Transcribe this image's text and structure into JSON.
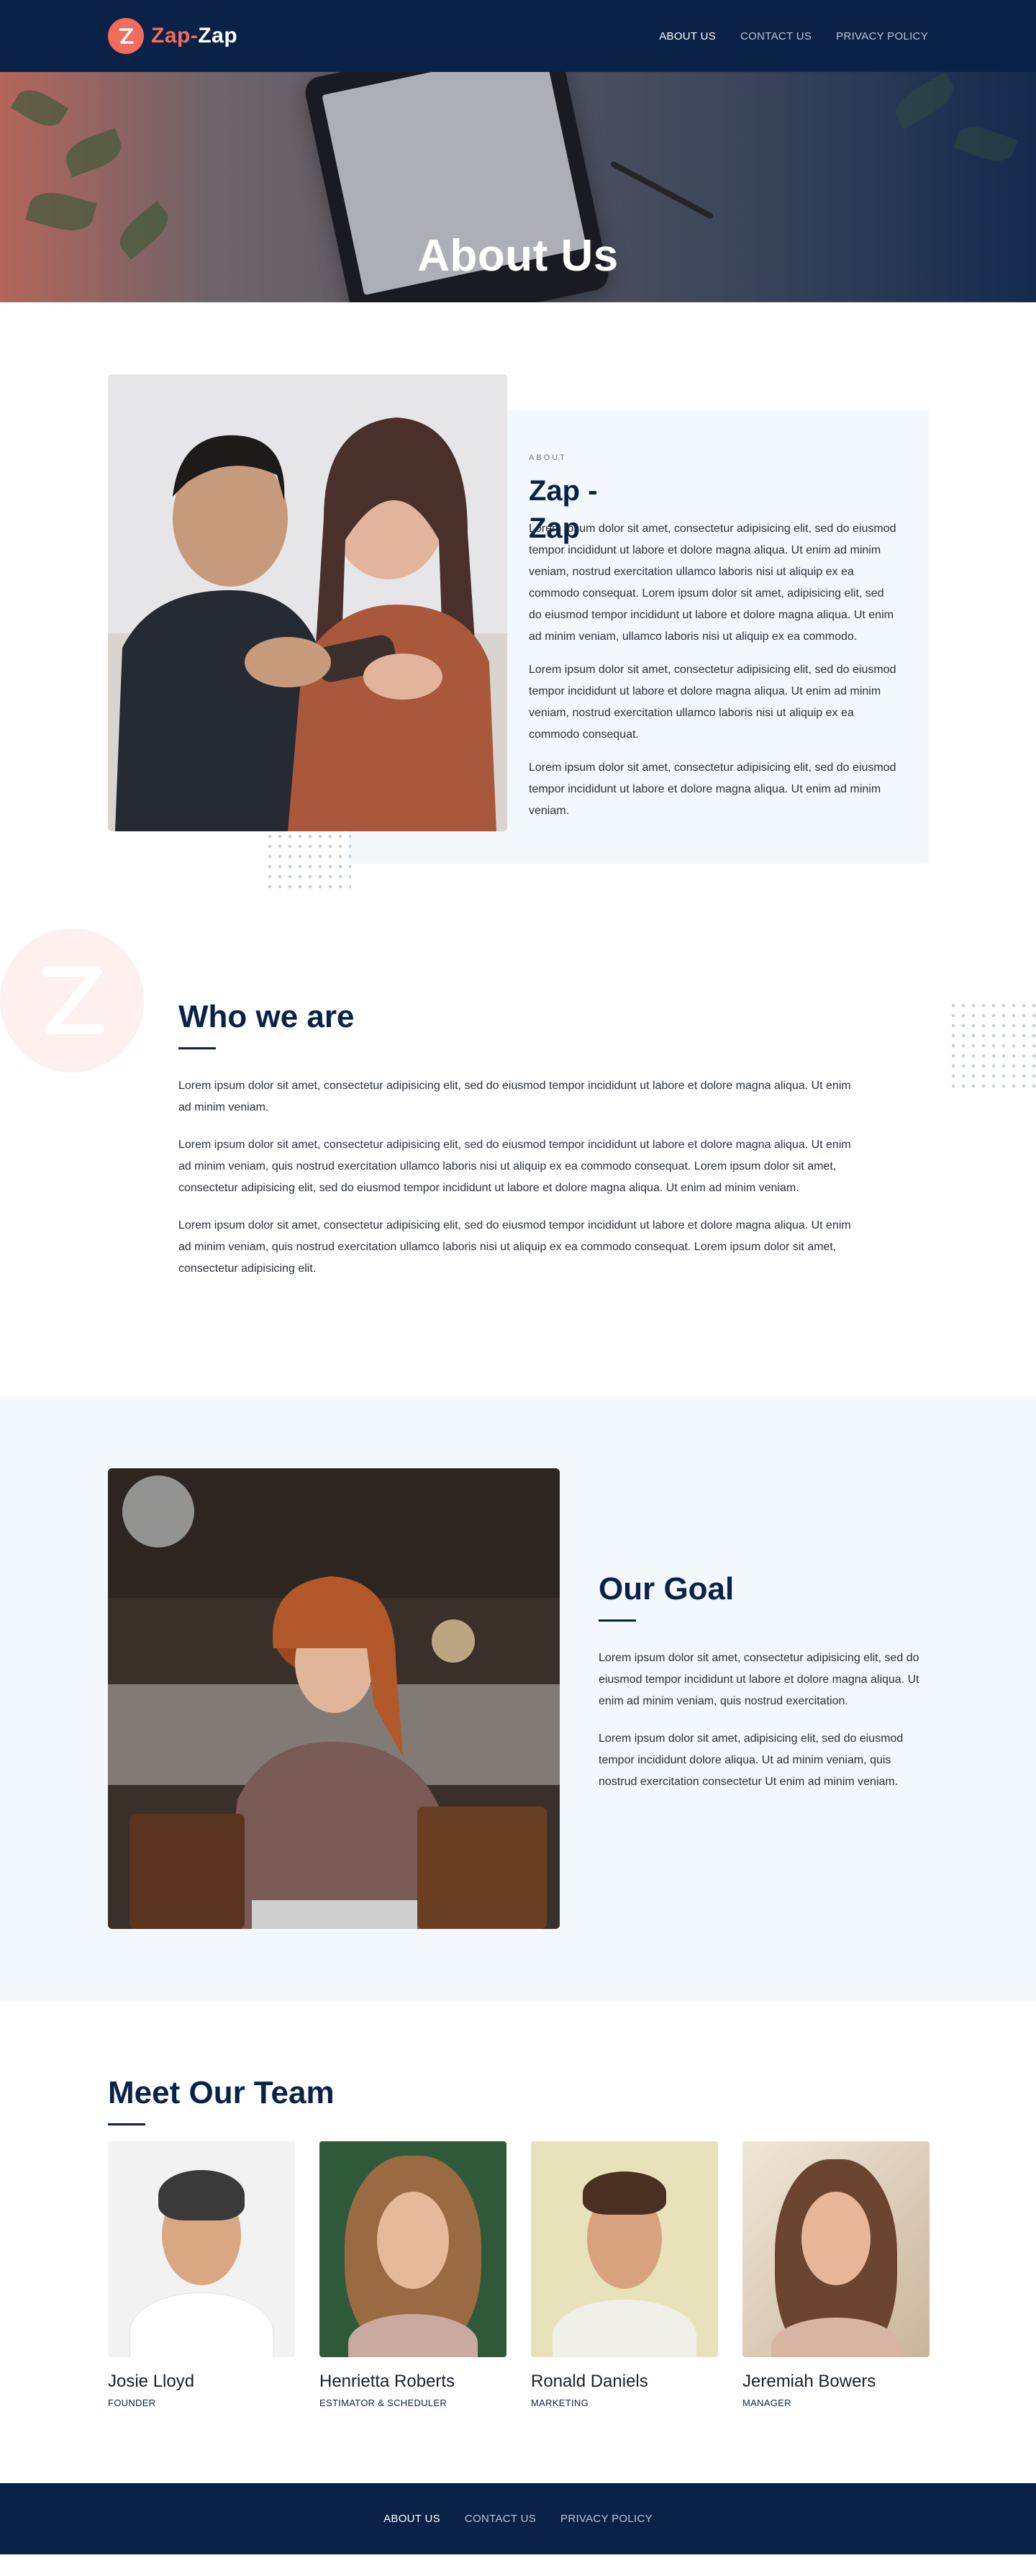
{
  "brand": {
    "name_part1": "Zap",
    "separator": "-",
    "name_part2": "Zap",
    "logo_icon": "z-logo-icon",
    "accent_color": "#f26b5b",
    "navy_color": "#0b2248"
  },
  "nav": {
    "items": [
      {
        "label": "ABOUT US",
        "active": true
      },
      {
        "label": "CONTACT US",
        "active": false
      },
      {
        "label": "PRIVACY POLICY",
        "active": false
      }
    ]
  },
  "hero": {
    "title": "About Us"
  },
  "about": {
    "eyebrow": "ABOUT",
    "heading": "Zap - Zap",
    "paragraphs": [
      "Lorem ipsum dolor sit amet, consectetur adipisicing elit, sed do eiusmod tempor incididunt ut labore et dolore magna aliqua. Ut enim ad minim veniam, nostrud exercitation ullamco laboris nisi ut aliquip ex ea commodo consequat. Lorem ipsum dolor sit amet, adipisicing elit, sed do eiusmod tempor incididunt ut labore et dolore magna aliqua. Ut enim ad minim veniam, ullamco laboris nisi ut aliquip ex ea commodo.",
      "Lorem ipsum dolor sit amet, consectetur adipisicing elit, sed do eiusmod tempor incididunt ut labore et dolore magna aliqua. Ut enim ad minim veniam, nostrud exercitation ullamco laboris nisi ut aliquip ex ea commodo consequat.",
      "Lorem ipsum dolor sit amet, consectetur adipisicing elit, sed do eiusmod tempor incididunt ut labore et dolore magna aliqua. Ut enim ad minim veniam."
    ]
  },
  "who": {
    "title": "Who we are",
    "paragraphs": [
      "Lorem ipsum dolor sit amet, consectetur adipisicing elit, sed do eiusmod tempor incididunt ut labore et dolore magna aliqua. Ut enim ad minim veniam.",
      "Lorem ipsum dolor sit amet, consectetur adipisicing elit, sed do eiusmod tempor incididunt ut labore et dolore magna aliqua. Ut enim ad minim veniam, quis nostrud exercitation ullamco laboris nisi ut aliquip ex ea commodo consequat. Lorem ipsum dolor sit amet, consectetur adipisicing elit, sed do eiusmod tempor incididunt ut labore et dolore magna aliqua. Ut enim ad minim veniam.",
      "Lorem ipsum dolor sit amet, consectetur adipisicing elit, sed do eiusmod tempor incididunt ut labore et dolore magna aliqua. Ut enim ad minim veniam, quis nostrud exercitation ullamco laboris nisi ut aliquip ex ea commodo consequat. Lorem ipsum dolor sit amet, consectetur adipisicing elit."
    ]
  },
  "goal": {
    "title": "Our Goal",
    "paragraphs": [
      "Lorem ipsum dolor sit amet, consectetur adipisicing elit, sed do eiusmod tempor incididunt ut labore et dolore magna aliqua. Ut enim ad minim veniam, quis nostrud exercitation.",
      "Lorem ipsum dolor sit amet, adipisicing elit, sed do eiusmod tempor incididunt dolore aliqua. Ut ad minim veniam, quis nostrud exercitation consectetur Ut enim ad minim veniam."
    ]
  },
  "team": {
    "title": "Meet Our Team",
    "members": [
      {
        "name": "Josie Lloyd",
        "role": "FOUNDER"
      },
      {
        "name": "Henrietta Roberts",
        "role": "ESTIMATOR & SCHEDULER"
      },
      {
        "name": "Ronald Daniels",
        "role": "MARKETING"
      },
      {
        "name": "Jeremiah Bowers",
        "role": "MANAGER"
      }
    ]
  },
  "footer": {
    "items": [
      {
        "label": "ABOUT US",
        "active": true
      },
      {
        "label": "CONTACT US",
        "active": false
      },
      {
        "label": "PRIVACY POLICY",
        "active": false
      }
    ]
  }
}
